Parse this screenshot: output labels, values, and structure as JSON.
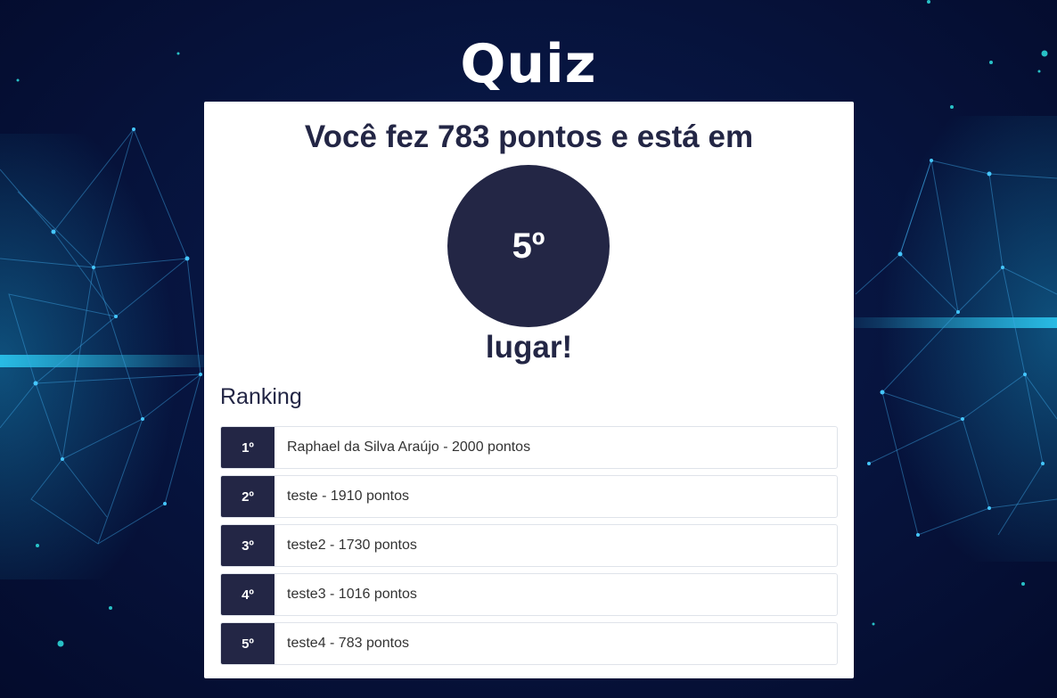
{
  "app": {
    "title": "Quiz"
  },
  "result": {
    "heading": "Você fez 783 pontos e está em",
    "place": "5º",
    "tail": "lugar!"
  },
  "ranking": {
    "title": "Ranking",
    "entries": [
      {
        "position": "1º",
        "text": "Raphael da Silva Araújo - 2000 pontos"
      },
      {
        "position": "2º",
        "text": "teste - 1910 pontos"
      },
      {
        "position": "3º",
        "text": "teste2 - 1730 pontos"
      },
      {
        "position": "4º",
        "text": "teste3 - 1016 pontos"
      },
      {
        "position": "5º",
        "text": "teste4 - 783 pontos"
      }
    ]
  },
  "colors": {
    "background": "#071540",
    "accent": "#232645",
    "network_glow": "#1ec8ff",
    "card": "#ffffff"
  }
}
